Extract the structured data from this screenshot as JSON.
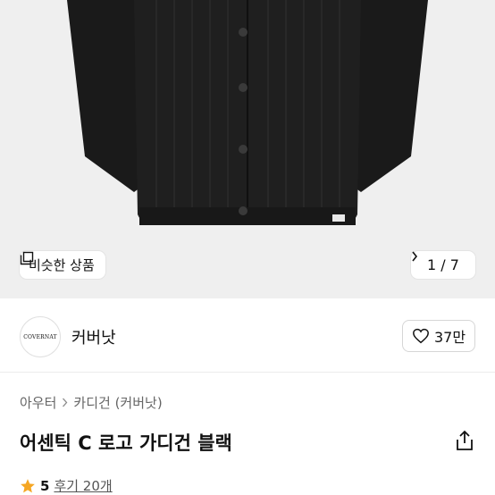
{
  "gallery": {
    "similar_label": "비슷한 상품",
    "pager_text": "1 / 7"
  },
  "brand": {
    "logo_text": "COVERNAT",
    "name": "커버낫",
    "likes": "37만"
  },
  "breadcrumb": {
    "level1": "아우터",
    "level2": "카디건 (커버낫)"
  },
  "product": {
    "title": "어센틱 C 로고 가디건 블랙"
  },
  "rating": {
    "score": "5",
    "reviews": "후기 20개"
  },
  "colors": {
    "star": "#f5a623",
    "garment": "#1c1c1c",
    "background": "#efefef"
  }
}
